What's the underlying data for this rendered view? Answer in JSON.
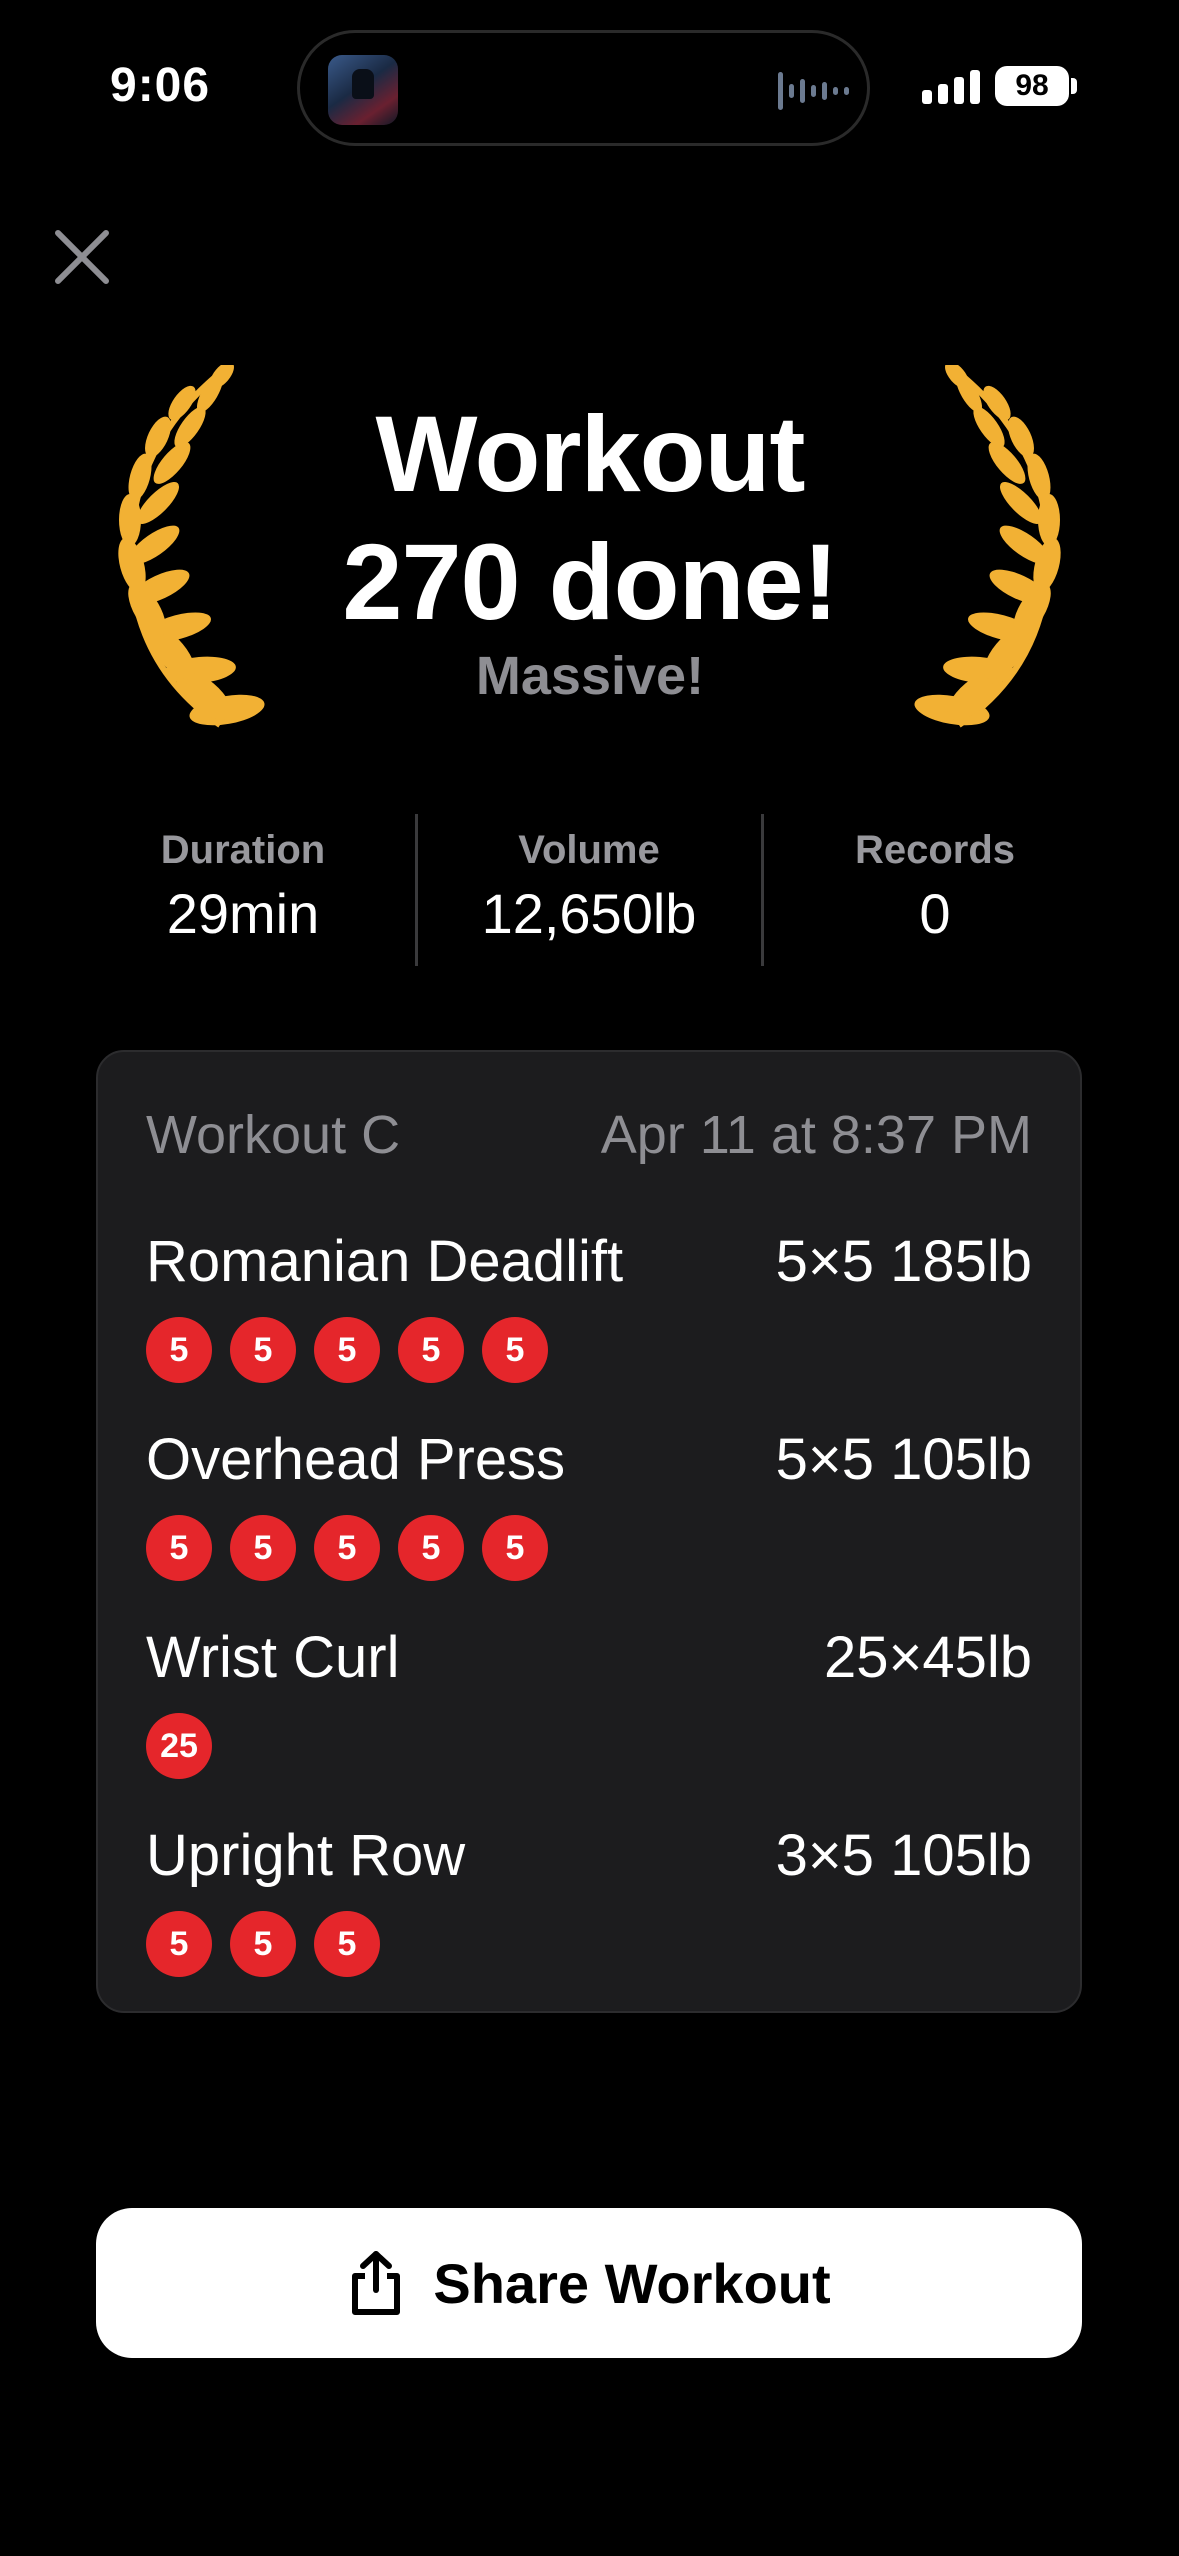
{
  "status_bar": {
    "time": "9:06",
    "battery": "98"
  },
  "header": {
    "title_line1": "Workout",
    "title_line2": "270 done!",
    "subtitle": "Massive!"
  },
  "stats": [
    {
      "label": "Duration",
      "value": "29min"
    },
    {
      "label": "Volume",
      "value": "12,650lb"
    },
    {
      "label": "Records",
      "value": "0"
    }
  ],
  "workout": {
    "name": "Workout C",
    "date": "Apr 11 at 8:37 PM",
    "exercises": [
      {
        "name": "Romanian Deadlift",
        "summary": "5×5 185lb",
        "reps": [
          "5",
          "5",
          "5",
          "5",
          "5"
        ]
      },
      {
        "name": "Overhead Press",
        "summary": "5×5 105lb",
        "reps": [
          "5",
          "5",
          "5",
          "5",
          "5"
        ]
      },
      {
        "name": "Wrist Curl",
        "summary": "25×45lb",
        "reps": [
          "25"
        ]
      },
      {
        "name": "Upright Row",
        "summary": "3×5 105lb",
        "reps": [
          "5",
          "5",
          "5"
        ]
      }
    ]
  },
  "share_button": {
    "label": "Share Workout"
  },
  "colors": {
    "accent_red": "#e5262b",
    "laurel_gold": "#f2b134",
    "card_bg": "#1c1c1e",
    "muted": "#8e8e93"
  },
  "icons": [
    "close-icon",
    "laurel-left-icon",
    "laurel-right-icon",
    "share-icon",
    "signal-icon",
    "battery-icon"
  ]
}
